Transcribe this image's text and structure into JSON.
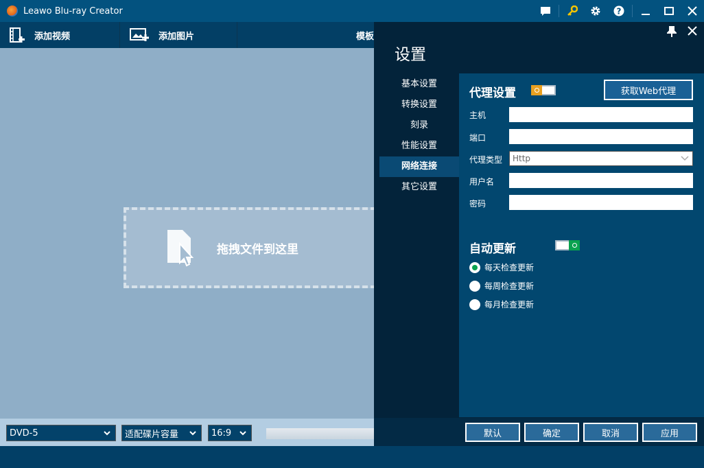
{
  "window": {
    "title": "Leawo Blu-ray Creator"
  },
  "toolbar": {
    "add_video": "添加视频",
    "add_image": "添加图片",
    "template": "模板"
  },
  "main": {
    "drop_text": "拖拽文件到这里"
  },
  "bottom": {
    "disc_type": "DVD-5",
    "fit_mode": "适配碟片容量",
    "aspect": "16:9"
  },
  "settings": {
    "title": "设置",
    "nav": [
      "基本设置",
      "转换设置",
      "刻录",
      "性能设置",
      "网络连接",
      "其它设置"
    ],
    "active_nav": "网络连接",
    "proxy": {
      "heading": "代理设置",
      "toggle_on": false,
      "get_web_proxy": "获取Web代理",
      "host_label": "主机",
      "host_value": "",
      "port_label": "端口",
      "port_value": "",
      "type_label": "代理类型",
      "type_value": "Http",
      "user_label": "用户名",
      "user_value": "",
      "pass_label": "密码",
      "pass_value": ""
    },
    "update": {
      "heading": "自动更新",
      "toggle_on": true,
      "options": [
        "每天检查更新",
        "每周检查更新",
        "每月检查更新"
      ],
      "selected": "每天检查更新"
    },
    "buttons": {
      "default": "默认",
      "ok": "确定",
      "cancel": "取消",
      "apply": "应用"
    }
  },
  "colors": {
    "accent_orange": "#e8a020",
    "accent_green": "#0aa24f",
    "key_icon": "#f5c400"
  }
}
